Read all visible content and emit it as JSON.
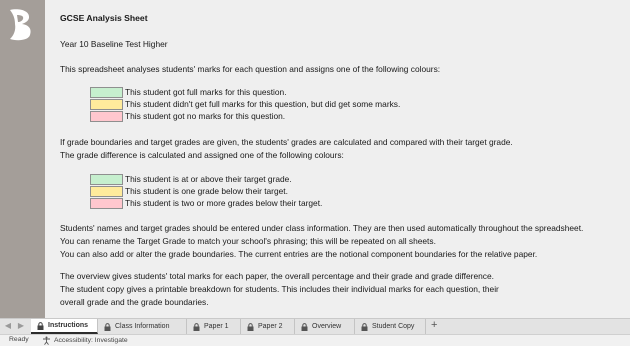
{
  "document": {
    "title": "GCSE Analysis Sheet",
    "subtitle": "Year 10 Baseline Test Higher",
    "intro": "This spreadsheet analyses students' marks for each question and assigns one of the following colours:",
    "marks_key": [
      {
        "color": "#c6efce",
        "label": "This student got full marks for this question."
      },
      {
        "color": "#ffeb9c",
        "label": "This student didn't get full marks for this question, but did get some marks."
      },
      {
        "color": "#ffc7ce",
        "label": "This student got no marks for this question."
      }
    ],
    "grade_para_1": "If grade boundaries and target grades are given, the students' grades are calculated and compared with their target grade.",
    "grade_para_2": "The grade difference is calculated and assigned one of the following colours:",
    "grade_key": [
      {
        "color": "#c6efce",
        "label": "This student is at or above their target grade."
      },
      {
        "color": "#ffeb9c",
        "label": "This student is one grade below their target."
      },
      {
        "color": "#ffc7ce",
        "label": "This student is two or more grades below their target."
      }
    ],
    "info_lines": [
      "Students' names and target grades should be entered under class information. They are then used automatically throughout the spreadsheet.",
      "You can rename the Target Grade to match your school's phrasing; this will be repeated on all sheets.",
      "You can also add or alter the grade boundaries. The current entries are the notional component boundaries for the relative paper."
    ],
    "overview_lines": [
      "The overview gives students' total marks for each paper, the overall percentage and their grade and grade difference.",
      "The student copy gives a printable breakdown for students. This includes their individual marks for each question, their",
      "overall grade and the grade boundaries."
    ]
  },
  "tabs": [
    {
      "label": "Instructions",
      "active": true
    },
    {
      "label": "Class Information"
    },
    {
      "label": "Paper 1"
    },
    {
      "label": "Paper 2"
    },
    {
      "label": "Overview"
    },
    {
      "label": "Student Copy"
    }
  ],
  "add_sheet_label": "+",
  "status": {
    "ready": "Ready",
    "accessibility": "Accessibility: Investigate"
  }
}
